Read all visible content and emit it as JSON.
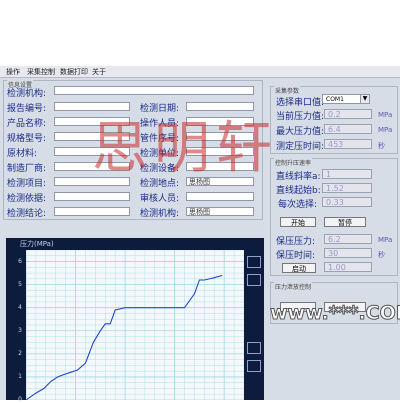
{
  "menu": [
    "操作",
    "采集控制",
    "数据打印",
    "关于"
  ],
  "left_group_title": "信息设置",
  "info_fields": [
    {
      "label": "检测机构:",
      "value": ""
    },
    {
      "label": "报告编号:",
      "value": ""
    },
    {
      "label": "产品名称:",
      "value": ""
    },
    {
      "label": "规格型号:",
      "value": ""
    },
    {
      "label": "原材料:",
      "value": ""
    },
    {
      "label": "制造厂商:",
      "value": ""
    },
    {
      "label": "检测项目:",
      "value": ""
    },
    {
      "label": "检测依据:",
      "value": ""
    },
    {
      "label": "检测结论:",
      "value": ""
    }
  ],
  "info_fields_right": [
    {
      "label": "检测日期:",
      "value": ""
    },
    {
      "label": "操作人员:",
      "value": ""
    },
    {
      "label": "管件序号:",
      "value": ""
    },
    {
      "label": "检测单位:",
      "value": ""
    },
    {
      "label": "检测设备:",
      "value": ""
    },
    {
      "label": "检测地点:",
      "value": "思杨图"
    },
    {
      "label": "审核人员:",
      "value": ""
    },
    {
      "label": "检测机构:",
      "value": "思杨图"
    }
  ],
  "params": {
    "title": "采集参数",
    "port_label": "选择串口值:",
    "port_value": "COM1",
    "rows": [
      {
        "label": "当前压力值:",
        "value": "0.2",
        "unit": "MPa"
      },
      {
        "label": "最大压力值:",
        "value": "6.4",
        "unit": "MPa"
      },
      {
        "label": "测定压时间:",
        "value": "453",
        "unit": "秒"
      }
    ]
  },
  "control": {
    "title": "控制升压速率",
    "rows": [
      {
        "label": "直线斜率a:",
        "value": "1"
      },
      {
        "label": "直线起始b:",
        "value": "1.52"
      },
      {
        "label": "每次选择:",
        "value": "0.33"
      }
    ],
    "start_label": "开始",
    "stop_label": "暂停",
    "hold_rows": [
      {
        "label": "保压压力:",
        "value": "6.2",
        "unit": "MPa"
      },
      {
        "label": "保压时间:",
        "value": "30",
        "unit": "秒"
      }
    ],
    "launch_label": "启动",
    "launch_value": "1.00"
  },
  "relief": {
    "title": "压力泄放控制"
  },
  "chart_data": {
    "type": "line",
    "title": "压力(MPa)",
    "y_ticks": [
      "6",
      "5",
      "4",
      "3",
      "2",
      "1",
      "0"
    ],
    "ylim": [
      0,
      6.5
    ],
    "x": [
      0,
      10,
      18,
      25,
      32,
      38,
      45,
      52,
      60,
      68,
      75,
      80,
      85,
      90,
      100,
      120,
      140,
      160,
      170,
      175,
      180,
      190,
      198
    ],
    "values": [
      0,
      0.3,
      0.5,
      0.8,
      1.0,
      1.1,
      1.2,
      1.3,
      1.6,
      2.5,
      3.0,
      3.3,
      3.3,
      3.9,
      4.0,
      4.0,
      4.0,
      4.0,
      4.6,
      5.2,
      5.2,
      5.3,
      5.4
    ]
  },
  "watermark": "思明轩",
  "watermark_url": "www.***.COM",
  "colors": {
    "line": "#2446c8",
    "grid": "#9fd8e3"
  }
}
